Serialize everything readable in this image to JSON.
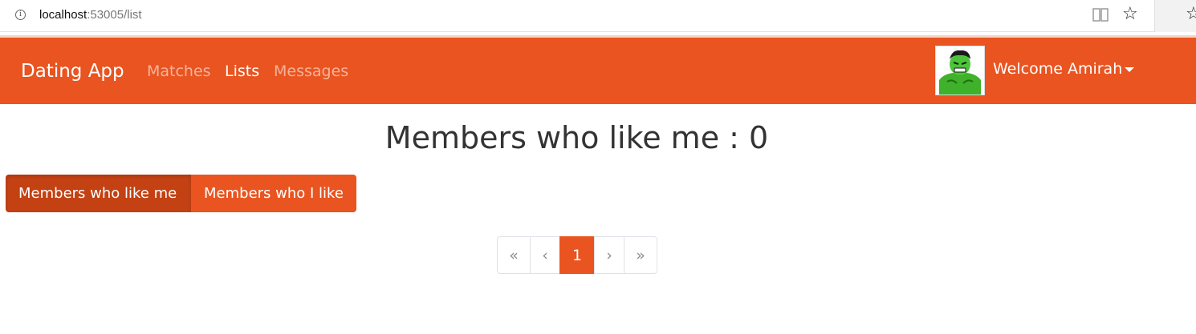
{
  "browser": {
    "url_host": "localhost",
    "url_rest": ":53005/list"
  },
  "navbar": {
    "brand": "Dating App",
    "links": [
      {
        "label": "Matches",
        "active": false
      },
      {
        "label": "Lists",
        "active": true
      },
      {
        "label": "Messages",
        "active": false
      }
    ],
    "welcome": "Welcome Amirah",
    "accent_color": "#e95420"
  },
  "page": {
    "title": "Members who like me : 0"
  },
  "filter": {
    "likers_label": "Members who like me",
    "likees_label": "Members who I like",
    "selected": "likers"
  },
  "pagination": {
    "first": "«",
    "prev": "‹",
    "current": "1",
    "next": "›",
    "last": "»"
  }
}
